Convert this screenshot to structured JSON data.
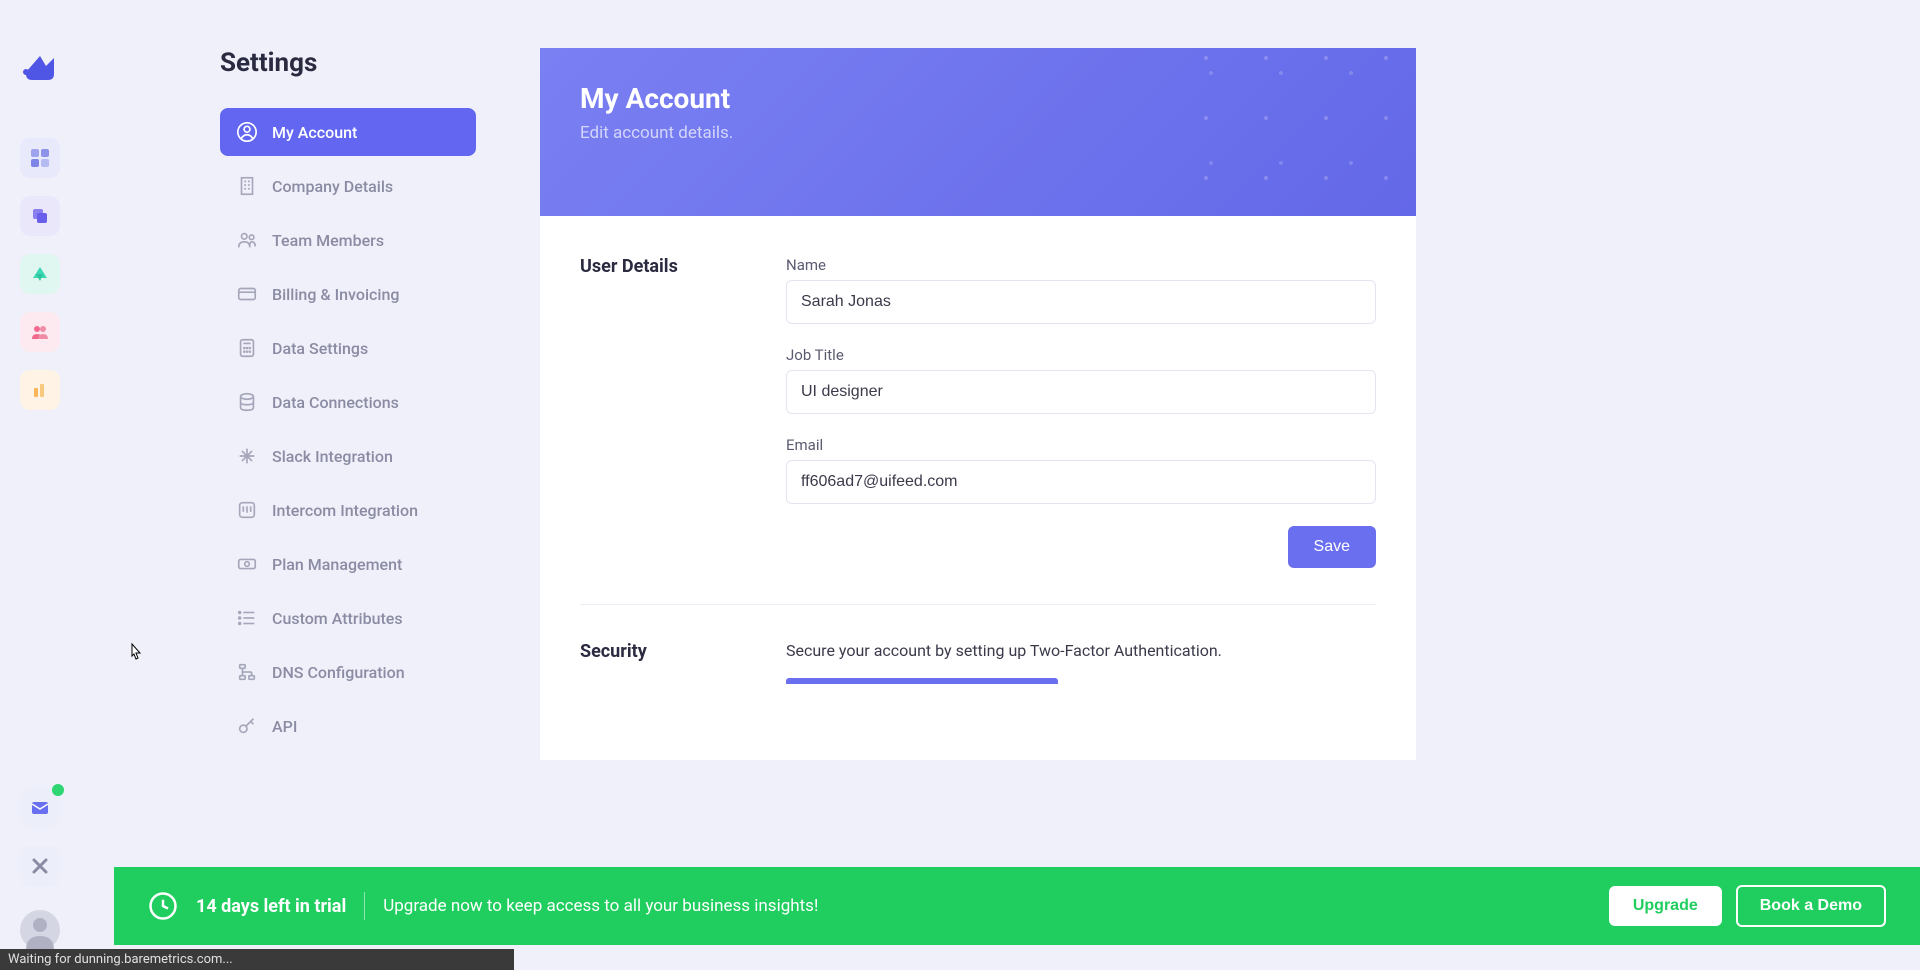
{
  "settings": {
    "title": "Settings",
    "items": [
      {
        "label": "My Account",
        "active": true,
        "icon": "user-circle"
      },
      {
        "label": "Company Details",
        "active": false,
        "icon": "building"
      },
      {
        "label": "Team Members",
        "active": false,
        "icon": "users"
      },
      {
        "label": "Billing & Invoicing",
        "active": false,
        "icon": "card"
      },
      {
        "label": "Data Settings",
        "active": false,
        "icon": "calc"
      },
      {
        "label": "Data Connections",
        "active": false,
        "icon": "db"
      },
      {
        "label": "Slack Integration",
        "active": false,
        "icon": "slack"
      },
      {
        "label": "Intercom Integration",
        "active": false,
        "icon": "intercom"
      },
      {
        "label": "Plan Management",
        "active": false,
        "icon": "money"
      },
      {
        "label": "Custom Attributes",
        "active": false,
        "icon": "list"
      },
      {
        "label": "DNS Configuration",
        "active": false,
        "icon": "dns"
      },
      {
        "label": "API",
        "active": false,
        "icon": "key"
      }
    ]
  },
  "main": {
    "header_title": "My Account",
    "header_subtitle": "Edit account details.",
    "user_details_label": "User Details",
    "fields": {
      "name_label": "Name",
      "name_value": "Sarah Jonas",
      "job_label": "Job Title",
      "job_value": "UI designer",
      "email_label": "Email",
      "email_value": "ff606ad7@uifeed.com"
    },
    "save_label": "Save",
    "security_label": "Security",
    "security_text": "Secure your account by setting up Two-Factor Authentication."
  },
  "trial": {
    "days_text": "14 days left in trial",
    "upgrade_text": "Upgrade now to keep access to all your business insights!",
    "upgrade_btn": "Upgrade",
    "demo_btn": "Book a Demo"
  },
  "status": "Waiting for dunning.baremetrics.com..."
}
